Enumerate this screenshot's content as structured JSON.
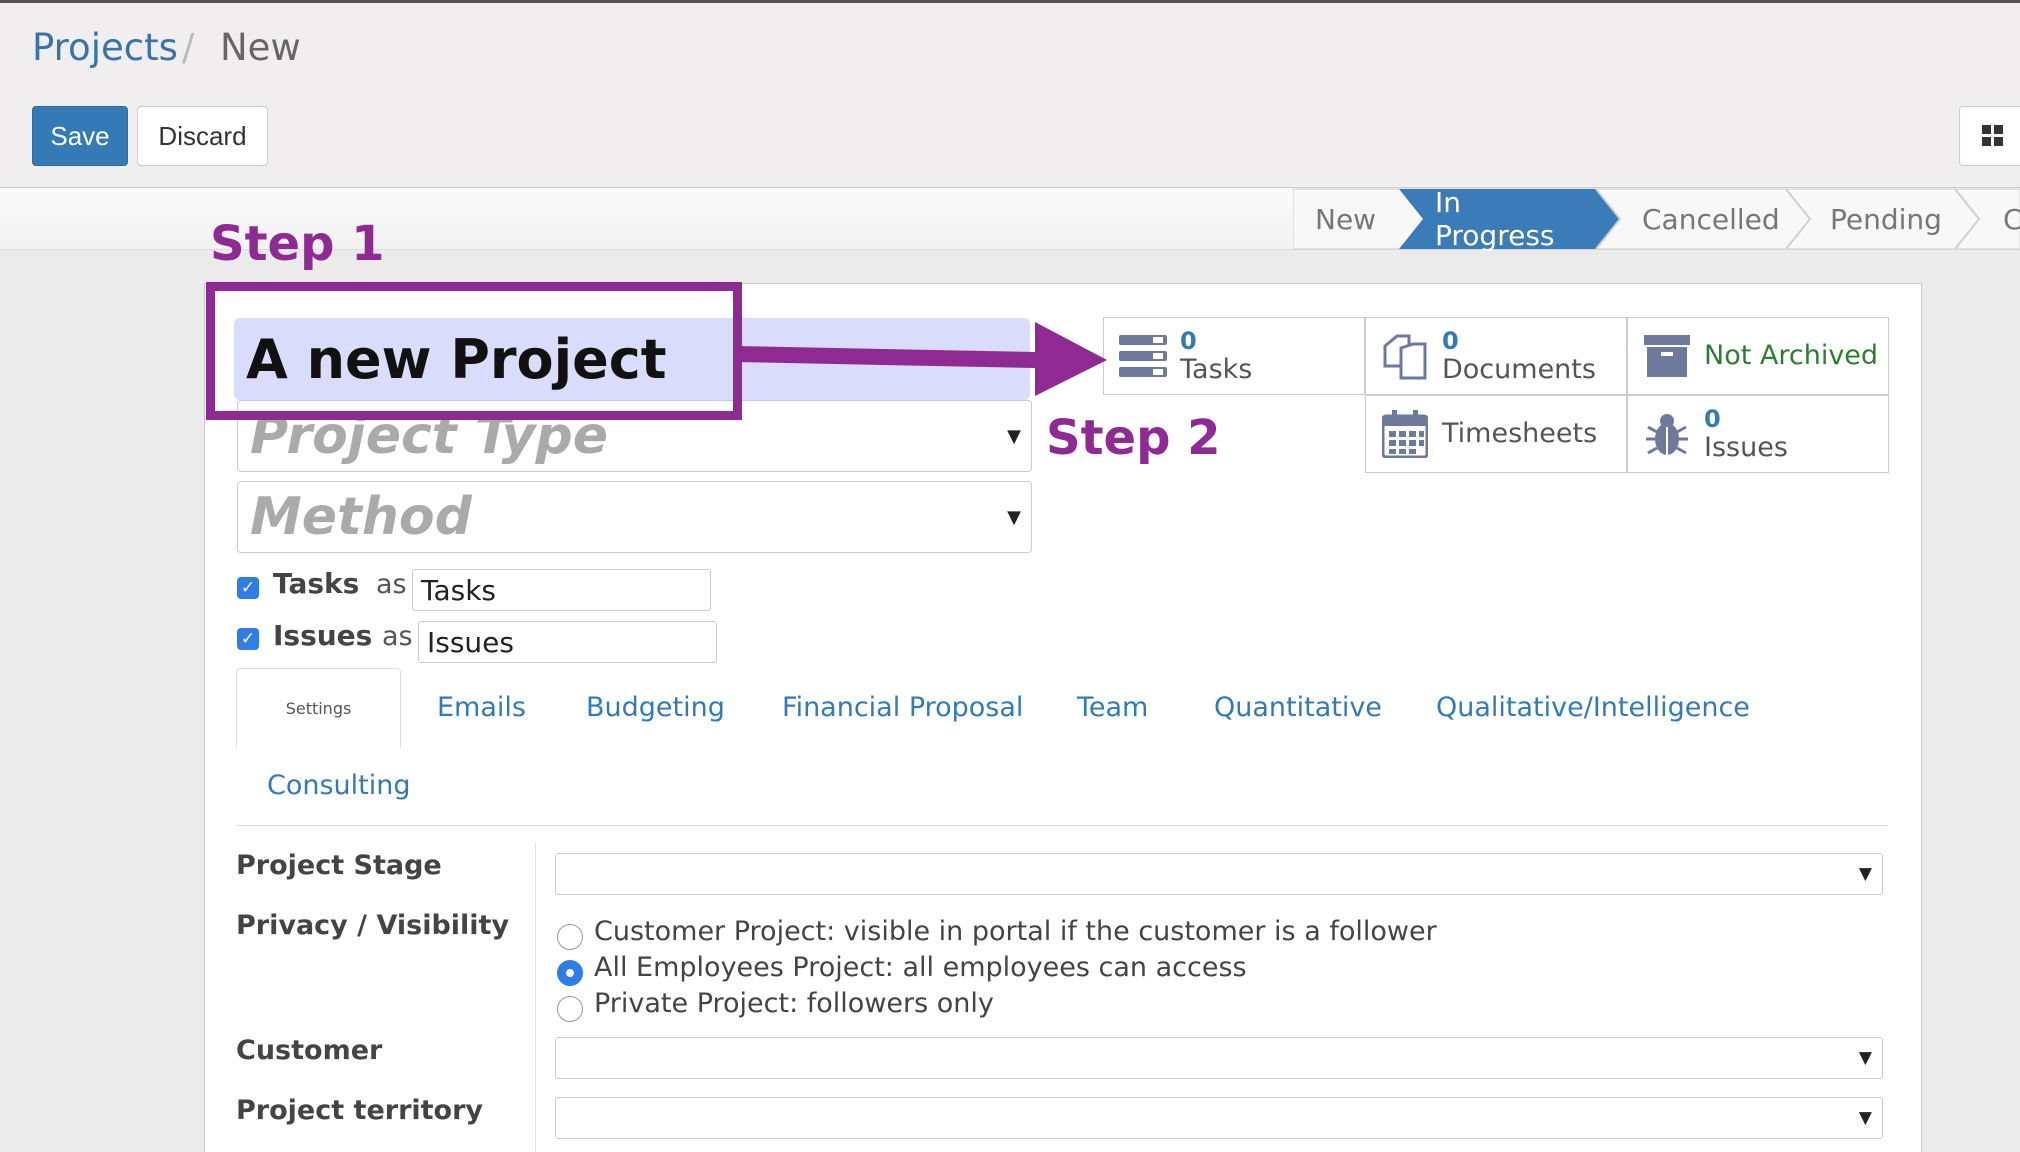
{
  "breadcrumb": {
    "root": "Projects",
    "separator": "/",
    "current": "New"
  },
  "toolbar": {
    "save_label": "Save",
    "discard_label": "Discard"
  },
  "stages": [
    {
      "label": "New",
      "active": false
    },
    {
      "label": "In Progress",
      "active": true
    },
    {
      "label": "Cancelled",
      "active": false
    },
    {
      "label": "Pending",
      "active": false
    },
    {
      "label": "C",
      "active": false
    }
  ],
  "form": {
    "title_value": "A new Project",
    "project_type_placeholder": "Project Type",
    "method_placeholder": "Method",
    "tasks_label": "Tasks",
    "issues_label": "Issues",
    "as_label": "as",
    "tasks_alias": "Tasks",
    "issues_alias": "Issues"
  },
  "smart_buttons": {
    "tasks": {
      "value": "0",
      "label": "Tasks",
      "icon": "tasks-icon"
    },
    "documents": {
      "value": "0",
      "label": "Documents",
      "icon": "documents-icon"
    },
    "archive": {
      "label": "Not Archived",
      "icon": "archive-icon"
    },
    "timesheets": {
      "label": "Timesheets",
      "icon": "calendar-icon"
    },
    "issues": {
      "value": "0",
      "label": "Issues",
      "icon": "bug-icon"
    }
  },
  "tabs": [
    "Settings",
    "Emails",
    "Budgeting",
    "Financial Proposal",
    "Team",
    "Quantitative",
    "Qualitative/Intelligence",
    "Consulting"
  ],
  "settings": {
    "project_stage_label": "Project Stage",
    "privacy_label": "Privacy / Visibility",
    "privacy_options": [
      "Customer Project: visible in portal if the customer is a follower",
      "All Employees Project: all employees can access",
      "Private Project: followers only"
    ],
    "privacy_selected": 1,
    "customer_label": "Customer",
    "territory_label": "Project territory"
  },
  "annotations": {
    "step1": "Step 1",
    "step2": "Step 2"
  },
  "colors": {
    "primary": "#337ab7",
    "annotation": "#8e2a91",
    "active_stage": "#337ab7",
    "archive_text": "#2e7d32",
    "icon_gray": "#6d7a9c"
  }
}
